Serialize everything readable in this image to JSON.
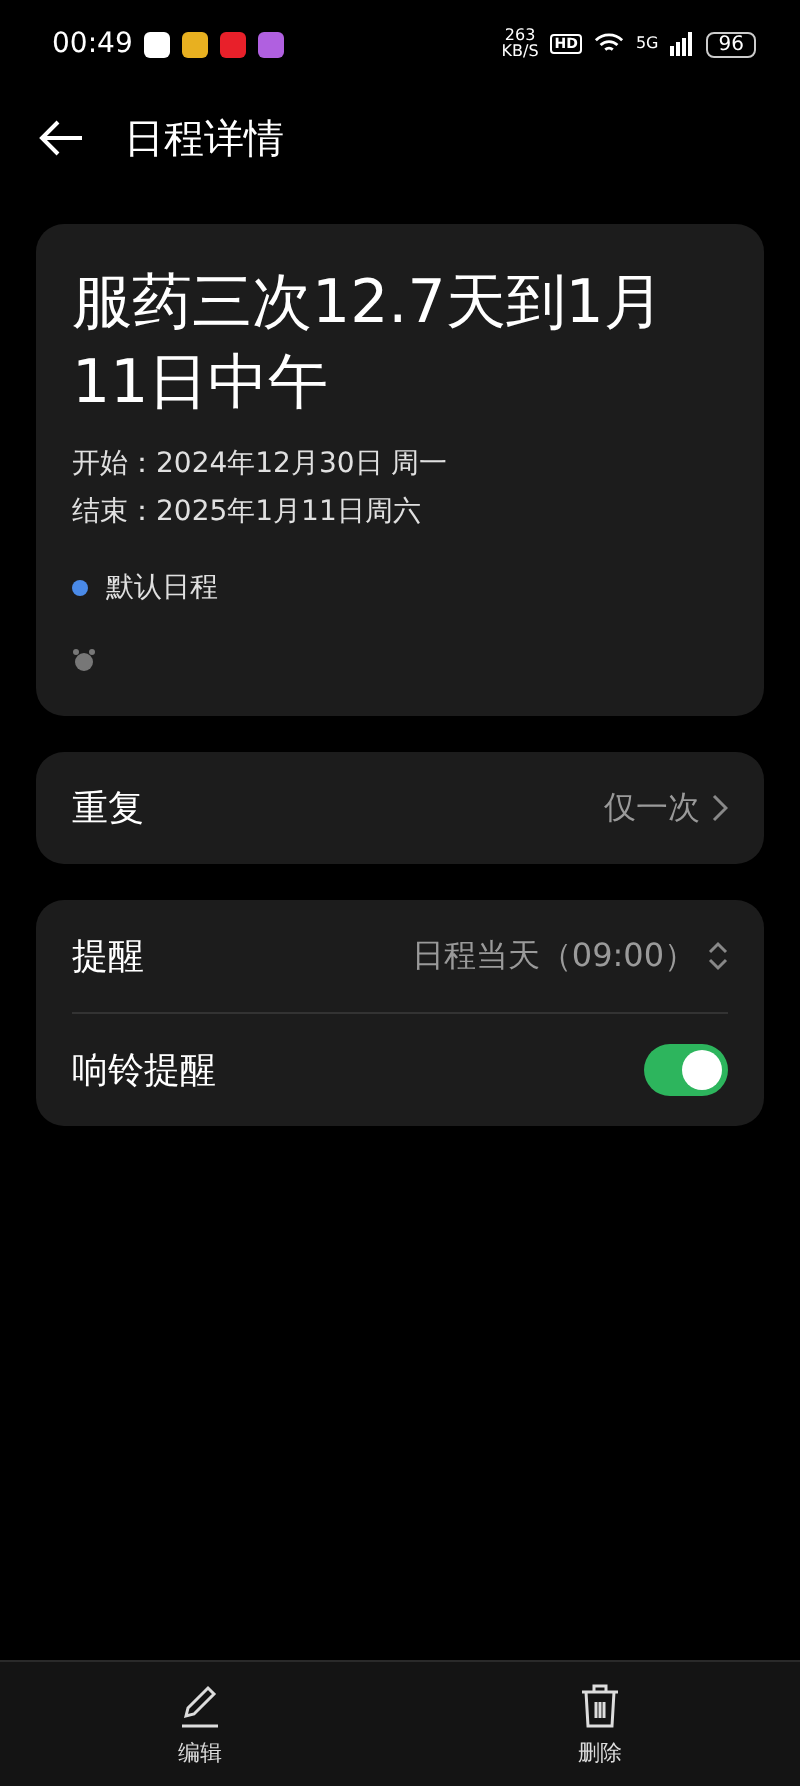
{
  "status_bar": {
    "time": "00:49",
    "app_icons": [
      {
        "color": "#ffffff"
      },
      {
        "color": "#e8b020"
      },
      {
        "color": "#e8202a"
      },
      {
        "color": "#b060e0"
      }
    ],
    "speed": "263",
    "speed_unit": "KB/S",
    "hd": "HD",
    "network": "5G",
    "battery": "96"
  },
  "header": {
    "title": "日程详情"
  },
  "event": {
    "title": "服药三次12.7天到1月11日中午",
    "start": "开始：2024年12月30日 周一",
    "end": "结束：2025年1月11日周六",
    "calendar": {
      "name": "默认日程",
      "color": "#4a8ae8"
    }
  },
  "repeat": {
    "label": "重复",
    "value": "仅一次"
  },
  "reminders": [
    {
      "kind": "select",
      "label": "提醒",
      "value": "日程当天（09:00）"
    },
    {
      "kind": "switch",
      "label": "响铃提醒",
      "on": true
    }
  ],
  "bottom_bar": [
    {
      "kind": "edit",
      "label": "编辑"
    },
    {
      "kind": "delete",
      "label": "删除"
    }
  ]
}
